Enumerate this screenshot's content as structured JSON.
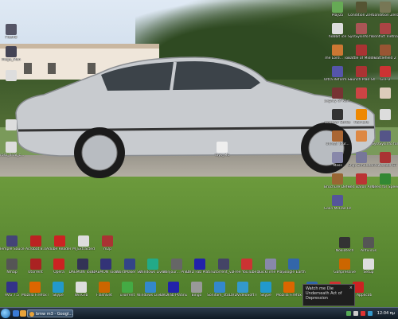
{
  "desktop_icons": {
    "left_column": [
      {
        "label": "Flash8",
        "icon": "app-icon",
        "color": "#556"
      },
      {
        "label": "Mega_Man",
        "icon": "app-icon",
        "color": "#445"
      },
      {
        "label": "",
        "icon": "file-icon",
        "color": "#ddd"
      },
      {
        "label": "",
        "icon": "file-icon",
        "color": "#ddd"
      },
      {
        "label": "cross_final_c...",
        "icon": "file-icon",
        "color": "#ddd"
      }
    ],
    "right_columns": [
      {
        "label": "Playz5",
        "icon": "game-icon",
        "color": "#6a5"
      },
      {
        "label": "Condition Zero Deleted Sce...",
        "icon": "game-icon",
        "color": "#553"
      },
      {
        "label": "Condition Zero",
        "icon": "game-icon",
        "color": "#775"
      },
      {
        "label": "hobbit ice",
        "icon": "file-icon",
        "color": "#ddd"
      },
      {
        "label": "Sys\\Sysinfo for BF-PS",
        "icon": "app-icon",
        "color": "#a55"
      },
      {
        "label": "Conflict Vietnam",
        "icon": "game-icon",
        "color": "#a44"
      },
      {
        "label": "The Lord... Tol...",
        "icon": "game-icon",
        "color": "#c73"
      },
      {
        "label": "Battle of Middle",
        "icon": "game-icon",
        "color": "#a33"
      },
      {
        "label": "Battlefield 2",
        "icon": "game-icon",
        "color": "#953"
      },
      {
        "label": "Ultra Reform Sonic...",
        "icon": "game-icon",
        "color": "#55a"
      },
      {
        "label": "Launch Plan Shoot Ultimate",
        "icon": "game-icon",
        "color": "#a33"
      },
      {
        "label": "GTF-2",
        "icon": "game-icon",
        "color": "#c33"
      },
      {
        "label": "Legacy of Kain Soul Reaver",
        "icon": "game-icon",
        "color": "#733"
      },
      {
        "label": "",
        "icon": "app-icon",
        "color": "#c44"
      },
      {
        "label": "",
        "icon": "app-icon",
        "color": "#dcb"
      },
      {
        "label": "Counter Strike",
        "icon": "game-icon",
        "color": "#333"
      },
      {
        "label": "Half-Life",
        "icon": "game-icon",
        "color": "#e80"
      },
      {
        "label": "",
        "icon": "game-icon",
        "color": "#ddd"
      },
      {
        "label": "Unreal Tour...",
        "icon": "game-icon",
        "color": "#a63"
      },
      {
        "label": "",
        "icon": "game-icon",
        "color": "#d84"
      },
      {
        "label": "Sys\\Sysinfo for BF...",
        "icon": "app-icon",
        "color": "#558"
      },
      {
        "label": "Mass",
        "icon": "game-icon",
        "color": "#88a"
      },
      {
        "label": "Ship Simulator 2008 Demo",
        "icon": "game-icon",
        "color": "#779"
      },
      {
        "label": "Powerball GT",
        "icon": "game-icon",
        "color": "#a33"
      },
      {
        "label": "Brochure Defector",
        "icon": "game-icon",
        "color": "#963"
      },
      {
        "label": "Red Baron Arcade",
        "icon": "game-icon",
        "color": "#b33"
      },
      {
        "label": "Need for Speed",
        "icon": "game-icon",
        "color": "#383"
      },
      {
        "label": "Colin McRae Rally 2005",
        "icon": "game-icon",
        "color": "#559"
      }
    ],
    "bottom_rows": [
      {
        "label": "Temple Sauce",
        "icon": "app-icon",
        "color": "#447"
      },
      {
        "label": "Acrobat 8.0",
        "icon": "app-icon",
        "color": "#b22"
      },
      {
        "label": "Adobe Reader 7.0",
        "icon": "app-icon",
        "color": "#c22"
      },
      {
        "label": "M_Extracted",
        "icon": "file-icon",
        "color": "#ddd"
      },
      {
        "label": "m2p",
        "icon": "app-icon",
        "color": "#a33"
      },
      {
        "label": "Nmap",
        "icon": "app-icon",
        "color": "#555"
      },
      {
        "label": "Utorrent",
        "icon": "app-icon",
        "color": "#a22"
      },
      {
        "label": "Opera",
        "icon": "app-icon",
        "color": "#c22"
      },
      {
        "label": "DAEMON Tools Lite",
        "icon": "app-icon",
        "color": "#335"
      },
      {
        "label": "DAEMON Tools... PRO 4.10.0",
        "icon": "app-icon",
        "color": "#337"
      },
      {
        "label": "WordMaker Screensaver",
        "icon": "app-icon",
        "color": "#348"
      },
      {
        "label": "Windows Live Messenger",
        "icon": "app-icon",
        "color": "#2a8"
      },
      {
        "label": "Bonjour... Printer Wizard",
        "icon": "app-icon",
        "color": "#666"
      },
      {
        "label": "DVD Fab Platinum",
        "icon": "app-icon",
        "color": "#22a"
      },
      {
        "label": "utorrent_v2",
        "icon": "app-icon",
        "color": "#446"
      },
      {
        "label": "Free YouTube to Mp3 Con...",
        "icon": "app-icon",
        "color": "#c33"
      },
      {
        "label": "QuickTime Player",
        "icon": "app-icon",
        "color": "#88a"
      },
      {
        "label": "Google Earth",
        "icon": "app-icon",
        "color": "#36a"
      },
      {
        "label": "Nokiatech",
        "icon": "app-icon",
        "color": "#333"
      },
      {
        "label": "Antivirus",
        "icon": "app-icon",
        "color": "#555"
      },
      {
        "label": "Gahpressive",
        "icon": "app-icon",
        "color": "#c60"
      },
      {
        "label": "Setup",
        "icon": "app-icon",
        "color": "#ddd"
      },
      {
        "label": "AVG 7.5",
        "icon": "app-icon",
        "color": "#338"
      },
      {
        "label": "Mozilla Firefox Beta 3",
        "icon": "app-icon",
        "color": "#d60"
      },
      {
        "label": "Skype",
        "icon": "app-icon",
        "color": "#29c"
      },
      {
        "label": "WinGrb",
        "icon": "app-icon",
        "color": "#ddd"
      },
      {
        "label": "FlashGet",
        "icon": "app-icon",
        "color": "#c60"
      },
      {
        "label": "uTorrent",
        "icon": "app-icon",
        "color": "#4a4"
      },
      {
        "label": "Windows Live Mail",
        "icon": "app-icon",
        "color": "#38c"
      },
      {
        "label": "DVDFab Platinum",
        "icon": "app-icon",
        "color": "#22a"
      },
      {
        "label": "Bingo",
        "icon": "app-icon",
        "color": "#999"
      },
      {
        "label": "Sonifam_sto...",
        "icon": "app-icon",
        "color": "#38c"
      },
      {
        "label": "DVDVideoSoft Free Studio",
        "icon": "app-icon",
        "color": "#39c"
      },
      {
        "label": "Skype",
        "icon": "app-icon",
        "color": "#29c"
      },
      {
        "label": "Mozilla Firefox",
        "icon": "app-icon",
        "color": "#d60"
      },
      {
        "label": "HP Install",
        "icon": "app-icon",
        "color": "#36a"
      },
      {
        "label": "4 EB Cafe",
        "icon": "app-icon",
        "color": "#c33"
      },
      {
        "label": "Install Application...",
        "icon": "app-icon",
        "color": "#c22"
      }
    ],
    "middle_items": [
      {
        "label": "Toys_MC",
        "icon": "file-icon",
        "color": "#eee"
      }
    ]
  },
  "notification": {
    "text": "Watch me Die Underneath Act of Depression",
    "close_glyph": "×"
  },
  "taskbar": {
    "active_task": "bmw m3 - Googl...",
    "clock": "12:04 πμ"
  }
}
